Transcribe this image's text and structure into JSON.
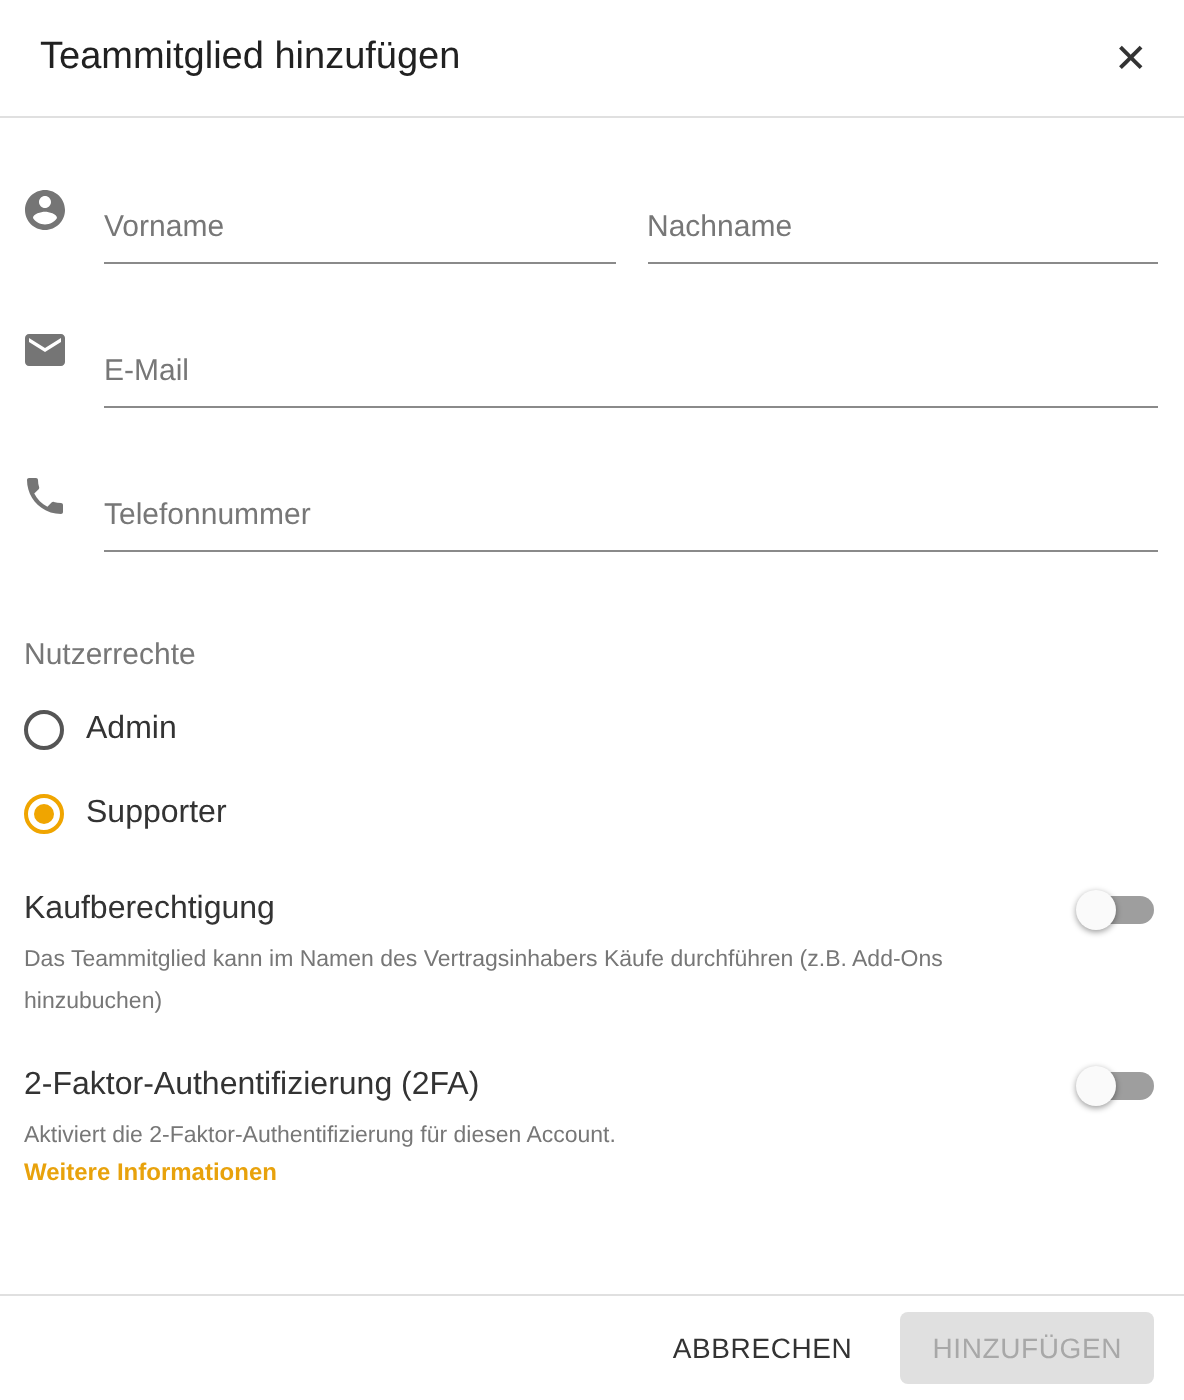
{
  "dialog": {
    "title": "Teammitglied hinzufügen",
    "close": "✕"
  },
  "field_rows": [
    {
      "kind": "person",
      "fields": [
        {
          "placeholder": "Vorname"
        },
        {
          "placeholder": "Nachname"
        }
      ]
    },
    {
      "kind": "mail",
      "fields": [
        {
          "placeholder": "E-Mail"
        }
      ]
    },
    {
      "kind": "phone",
      "fields": [
        {
          "placeholder": "Telefonnummer"
        }
      ]
    }
  ],
  "permissions": {
    "label": "Nutzerrechte",
    "options": [
      {
        "label": "Admin",
        "selected": false
      },
      {
        "label": "Supporter",
        "selected": true
      }
    ]
  },
  "settings": [
    {
      "title": "Kaufberechtigung",
      "description": "Das Teammitglied kann im Namen des Vertragsinhabers Käufe durchführen (z.B. Add-Ons hinzubuchen)",
      "on": false
    },
    {
      "title": "2-Faktor-Authentifizierung (2FA)",
      "description": "Aktiviert die 2-Faktor-Authentifizierung für diesen Account.",
      "link": "Weitere Informationen",
      "on": false
    }
  ],
  "buttons": [
    {
      "label": "ABBRECHEN",
      "disabled": false
    },
    {
      "label": "HINZUFÜGEN",
      "disabled": true
    }
  ]
}
